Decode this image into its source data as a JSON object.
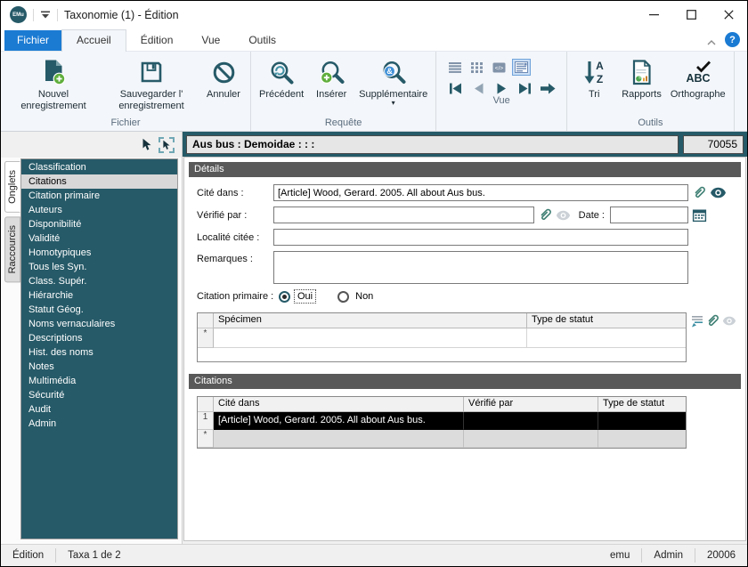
{
  "colors": {
    "teal": "#265A68",
    "accent": "#1B7BD3",
    "green": "#5FAE3C",
    "section": "#595959"
  },
  "window": {
    "app_badge": "EMu",
    "title": "Taxonomie (1) - Édition"
  },
  "ribbon": {
    "tabs": [
      {
        "label": "Fichier",
        "accent": true
      },
      {
        "label": "Accueil",
        "selected": true
      },
      {
        "label": "Édition"
      },
      {
        "label": "Vue"
      },
      {
        "label": "Outils"
      }
    ],
    "help_glyph": "?",
    "groups": [
      {
        "label": "Fichier"
      },
      {
        "label": "Requête"
      },
      {
        "label": "Vue"
      },
      {
        "label": "Outils"
      }
    ],
    "buttons": {
      "new_record": "Nouvel enregistrement",
      "save_record": "Sauvegarder l' enregistrement",
      "cancel": "Annuler",
      "previous": "Précédent",
      "insert": "Insérer",
      "additional": "Supplémentaire",
      "additional_caret": "▾",
      "sort": "Tri",
      "reports": "Rapports",
      "spelling": "Orthographe"
    },
    "view_selected": "form-view",
    "nav_disabled": "previous-record"
  },
  "record_header": {
    "summary": "Aus bus : Demoidae : : :",
    "irn": "70055"
  },
  "sidebar": {
    "tabs": [
      {
        "label": "Onglets",
        "selected": true
      },
      {
        "label": "Raccourcis"
      }
    ],
    "items": [
      {
        "label": "Classification"
      },
      {
        "label": "Citations",
        "selected": true
      },
      {
        "label": "Citation primaire"
      },
      {
        "label": "Auteurs"
      },
      {
        "label": "Disponibilité"
      },
      {
        "label": "Validité"
      },
      {
        "label": "Homotypiques"
      },
      {
        "label": "Tous les Syn."
      },
      {
        "label": "Class. Supér."
      },
      {
        "label": "Hiérarchie"
      },
      {
        "label": "Statut Géog."
      },
      {
        "label": "Noms vernaculaires"
      },
      {
        "label": "Descriptions"
      },
      {
        "label": "Hist. des noms"
      },
      {
        "label": "Notes"
      },
      {
        "label": "Multimédia"
      },
      {
        "label": "Sécurité"
      },
      {
        "label": "Audit"
      },
      {
        "label": "Admin"
      }
    ]
  },
  "details": {
    "section_title": "Détails",
    "cited_in_label": "Cité dans :",
    "cited_in_value": "[Article] Wood, Gerard. 2005. All about Aus bus.",
    "verified_by_label": "Vérifié par :",
    "verified_by_value": "",
    "date_label": "Date :",
    "date_value": "",
    "cited_locality_label": "Localité citée :",
    "cited_locality_value": "",
    "remarks_label": "Remarques :",
    "remarks_value": "",
    "primary_citation_label": "Citation primaire :",
    "primary_citation_value": "Oui",
    "radio_yes": "Oui",
    "radio_no": "Non",
    "specimen_grid": {
      "columns": [
        "Spécimen",
        "Type de statut"
      ],
      "new_row_marker": "*"
    }
  },
  "citations": {
    "section_title": "Citations",
    "columns": [
      "Cité dans",
      "Vérifié par",
      "Type de statut"
    ],
    "rows": [
      {
        "num": "1",
        "cited_in": "[Article] Wood, Gerard. 2005. All about Aus bus.",
        "verified_by": "",
        "status_type": "",
        "selected": true
      }
    ],
    "new_row_marker": "*"
  },
  "status_bar": {
    "mode": "Édition",
    "record_position": "Taxa 1 de 2",
    "database": "emu",
    "user": "Admin",
    "port": "20006"
  }
}
